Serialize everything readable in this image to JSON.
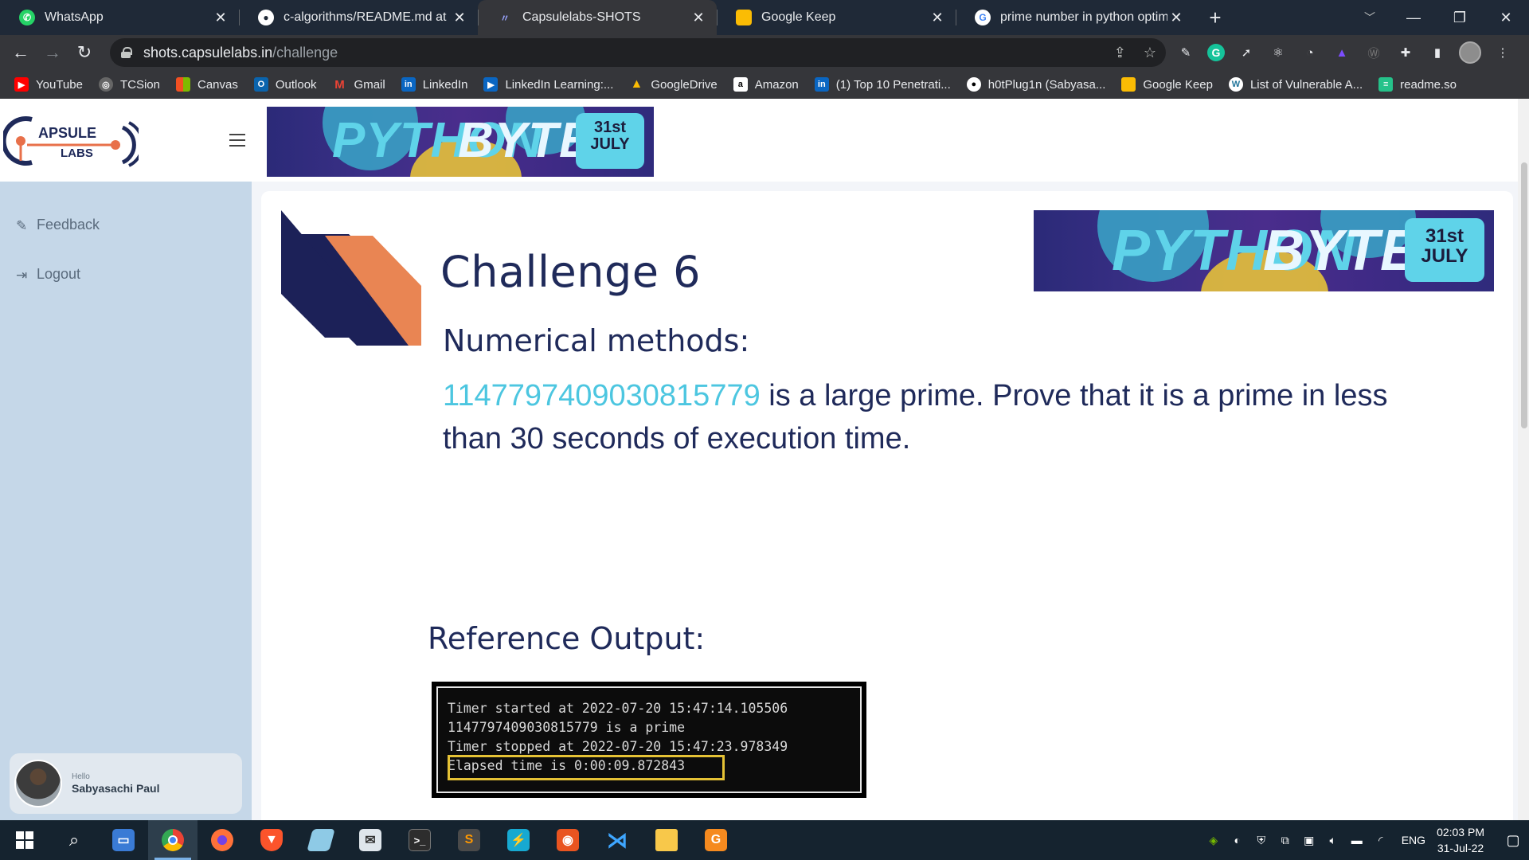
{
  "tabs": [
    {
      "title": "WhatsApp",
      "icon": "whatsapp-icon",
      "color": "#25d366",
      "active": false
    },
    {
      "title": "c-algorithms/README.md at mai",
      "icon": "github-icon",
      "color": "#ffffff",
      "active": false
    },
    {
      "title": "Capsulelabs-SHOTS",
      "icon": "capsulelabs-icon",
      "color": "#3b3b8f",
      "active": true
    },
    {
      "title": "Google Keep",
      "icon": "google-keep-icon",
      "color": "#fbbc04",
      "active": false
    },
    {
      "title": "prime number in python optimiz",
      "icon": "google-icon",
      "color": "#ffffff",
      "active": false
    }
  ],
  "omnibox": {
    "host": "shots.capsulelabs.in",
    "path": "/challenge"
  },
  "bookmarks": [
    {
      "label": "YouTube",
      "icon": "youtube-icon",
      "color": "#ff0000"
    },
    {
      "label": "TCSion",
      "icon": "tcsion-icon",
      "color": "#7b7b7b"
    },
    {
      "label": "Canvas",
      "icon": "microsoft-icon",
      "color": "#f25022"
    },
    {
      "label": "Outlook",
      "icon": "outlook-icon",
      "color": "#0a64ad"
    },
    {
      "label": "Gmail",
      "icon": "gmail-icon",
      "color": "#ea4335"
    },
    {
      "label": "LinkedIn",
      "icon": "linkedin-icon",
      "color": "#0a66c2"
    },
    {
      "label": "LinkedIn Learning:...",
      "icon": "linkedin-learning-icon",
      "color": "#0a66c2"
    },
    {
      "label": "GoogleDrive",
      "icon": "google-drive-icon",
      "color": "#1fa463"
    },
    {
      "label": "Amazon",
      "icon": "amazon-icon",
      "color": "#ffffff"
    },
    {
      "label": "(1) Top 10 Penetrati...",
      "icon": "linkedin-icon",
      "color": "#0a66c2"
    },
    {
      "label": "h0tPlug1n (Sabyasa...",
      "icon": "github-icon",
      "color": "#ffffff"
    },
    {
      "label": "Google Keep",
      "icon": "google-keep-icon",
      "color": "#fbbc04"
    },
    {
      "label": "List of Vulnerable A...",
      "icon": "wordpress-icon",
      "color": "#ffffff"
    },
    {
      "label": "readme.so",
      "icon": "readme-icon",
      "color": "#25c28a"
    }
  ],
  "sidebar": {
    "logo_top": "APSULE",
    "logo_bottom": "LABS",
    "items": [
      {
        "label": "Feedback",
        "icon": "edit-icon"
      },
      {
        "label": "Logout",
        "icon": "logout-icon"
      }
    ],
    "user": {
      "greeting": "Hello",
      "name": "Sabyasachi Paul"
    }
  },
  "banner": {
    "word1": "PYTHON",
    "word2": "BYTES",
    "date_day": "31st",
    "date_month": "JULY"
  },
  "challenge": {
    "title": "Challenge 6",
    "subtitle": "Numerical methods:",
    "number": "1147797409030815779",
    "statement": " is a large prime. Prove that it is a prime in less than 30 seconds of execution time.",
    "reference_title": "Reference Output:",
    "terminal_lines": [
      "Timer started at  2022-07-20 15:47:14.105506",
      "1147797409030815779 is a prime",
      "Timer stopped at  2022-07-20 15:47:23.978349",
      "Elapsed time is 0:00:09.872843"
    ]
  },
  "taskbar": {
    "apps": [
      {
        "name": "start",
        "icon": "windows-start-icon"
      },
      {
        "name": "search",
        "icon": "search-icon"
      },
      {
        "name": "explorer-desktop",
        "icon": "laptop-icon"
      },
      {
        "name": "chrome",
        "icon": "chrome-icon"
      },
      {
        "name": "firefox",
        "icon": "firefox-icon"
      },
      {
        "name": "brave",
        "icon": "brave-icon"
      },
      {
        "name": "app",
        "icon": "blue-app-icon"
      },
      {
        "name": "mail",
        "icon": "mail-app-icon"
      },
      {
        "name": "terminal",
        "icon": "terminal-icon"
      },
      {
        "name": "sublime",
        "icon": "sublime-icon"
      },
      {
        "name": "bolt",
        "icon": "bolt-icon"
      },
      {
        "name": "ubuntu",
        "icon": "ubuntu-icon"
      },
      {
        "name": "vscode",
        "icon": "vscode-icon"
      },
      {
        "name": "files",
        "icon": "folder-icon"
      },
      {
        "name": "pdf",
        "icon": "pdf-app-icon"
      }
    ],
    "language": "ENG",
    "time": "02:03 PM",
    "date": "31-Jul-22"
  }
}
